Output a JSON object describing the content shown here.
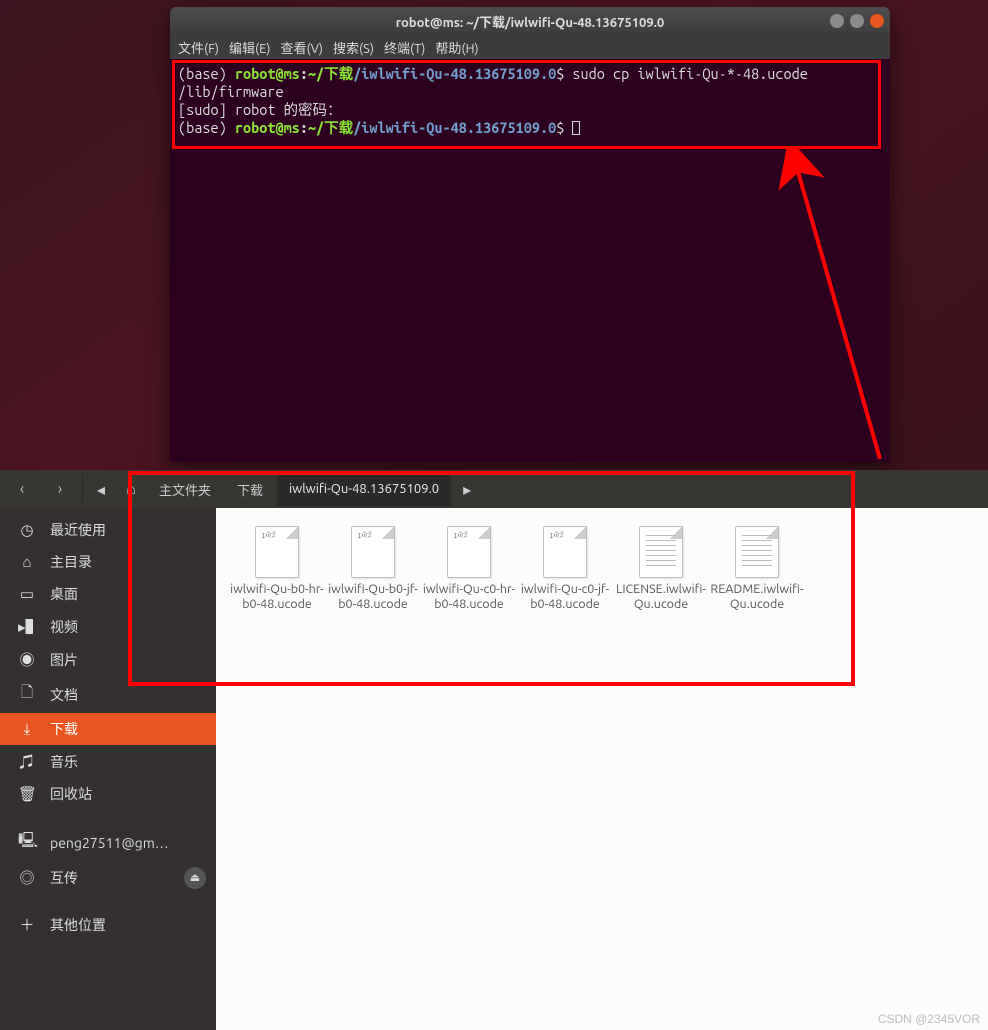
{
  "terminal": {
    "title": "robot@ms: ~/下载/iwlwifi-Qu-48.13675109.0",
    "menu": [
      "文件(F)",
      "编辑(E)",
      "查看(V)",
      "搜索(S)",
      "终端(T)",
      "帮助(H)"
    ],
    "prompt": {
      "base": "(base) ",
      "user": "robot@ms",
      "sep": ":",
      "tilde": "~/下载",
      "path": "/iwlwifi-Qu-48.13675109.0",
      "dollar": "$"
    },
    "line1_cmd": " sudo cp iwlwifi-Qu-*-48.ucode /lib/firmware",
    "line2": "[sudo] robot 的密码："
  },
  "file_manager": {
    "breadcrumb": {
      "home": "主文件夹",
      "downloads": "下载",
      "folder": "iwlwifi-Qu-48.13675109.0"
    },
    "sidebar": [
      {
        "icon": "◷",
        "label": "最近使用",
        "kind": "recent"
      },
      {
        "icon": "⌂",
        "label": "主目录",
        "kind": "home"
      },
      {
        "icon": "▭",
        "label": "桌面",
        "kind": "desktop"
      },
      {
        "icon": "▸▌",
        "label": "视频",
        "kind": "videos"
      },
      {
        "icon": "◉",
        "label": "图片",
        "kind": "pictures"
      },
      {
        "icon": "🗋",
        "label": "文档",
        "kind": "documents"
      },
      {
        "icon": "⤓",
        "label": "下载",
        "kind": "downloads",
        "active": true
      },
      {
        "icon": "♫",
        "label": "音乐",
        "kind": "music"
      },
      {
        "icon": "🗑",
        "label": "回收站",
        "kind": "trash"
      },
      {
        "icon": "🖳",
        "label": "peng27511@gm…",
        "kind": "network"
      },
      {
        "icon": "◎",
        "label": "互传",
        "kind": "mount",
        "eject": true
      },
      {
        "icon": "＋",
        "label": "其他位置",
        "kind": "other"
      }
    ],
    "files": [
      {
        "name": "iwlwifi-Qu-b0-hr-b0-48.ucode",
        "type": "bin"
      },
      {
        "name": "iwlwifi-Qu-b0-jf-b0-48.ucode",
        "type": "bin"
      },
      {
        "name": "iwlwifi-Qu-c0-hr-b0-48.ucode",
        "type": "bin"
      },
      {
        "name": "iwlwifi-Qu-c0-jf-b0-48.ucode",
        "type": "bin"
      },
      {
        "name": "LICENSE.iwlwifi-Qu.ucode",
        "type": "txt"
      },
      {
        "name": "README.iwlwifi-Qu.ucode",
        "type": "txt"
      }
    ]
  },
  "watermark": "CSDN @2345VOR"
}
